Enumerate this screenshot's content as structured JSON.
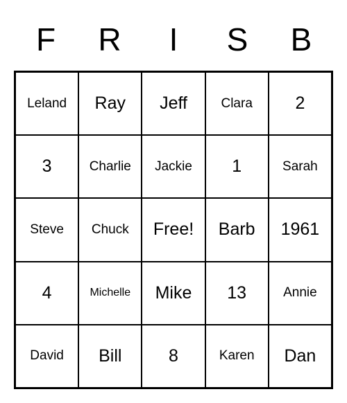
{
  "headers": [
    "F",
    "R",
    "I",
    "S",
    "B"
  ],
  "grid": [
    [
      {
        "text": "Leland",
        "size": "small"
      },
      {
        "text": "Ray",
        "size": "normal"
      },
      {
        "text": "Jeff",
        "size": "normal"
      },
      {
        "text": "Clara",
        "size": "small"
      },
      {
        "text": "2",
        "size": "normal"
      }
    ],
    [
      {
        "text": "3",
        "size": "normal"
      },
      {
        "text": "Charlie",
        "size": "small"
      },
      {
        "text": "Jackie",
        "size": "small"
      },
      {
        "text": "1",
        "size": "normal"
      },
      {
        "text": "Sarah",
        "size": "small"
      }
    ],
    [
      {
        "text": "Steve",
        "size": "small"
      },
      {
        "text": "Chuck",
        "size": "small"
      },
      {
        "text": "Free!",
        "size": "normal"
      },
      {
        "text": "Barb",
        "size": "normal"
      },
      {
        "text": "1961",
        "size": "normal"
      }
    ],
    [
      {
        "text": "4",
        "size": "normal"
      },
      {
        "text": "Michelle",
        "size": "xsmall"
      },
      {
        "text": "Mike",
        "size": "normal"
      },
      {
        "text": "13",
        "size": "normal"
      },
      {
        "text": "Annie",
        "size": "small"
      }
    ],
    [
      {
        "text": "David",
        "size": "small"
      },
      {
        "text": "Bill",
        "size": "normal"
      },
      {
        "text": "8",
        "size": "normal"
      },
      {
        "text": "Karen",
        "size": "small"
      },
      {
        "text": "Dan",
        "size": "normal"
      }
    ]
  ]
}
